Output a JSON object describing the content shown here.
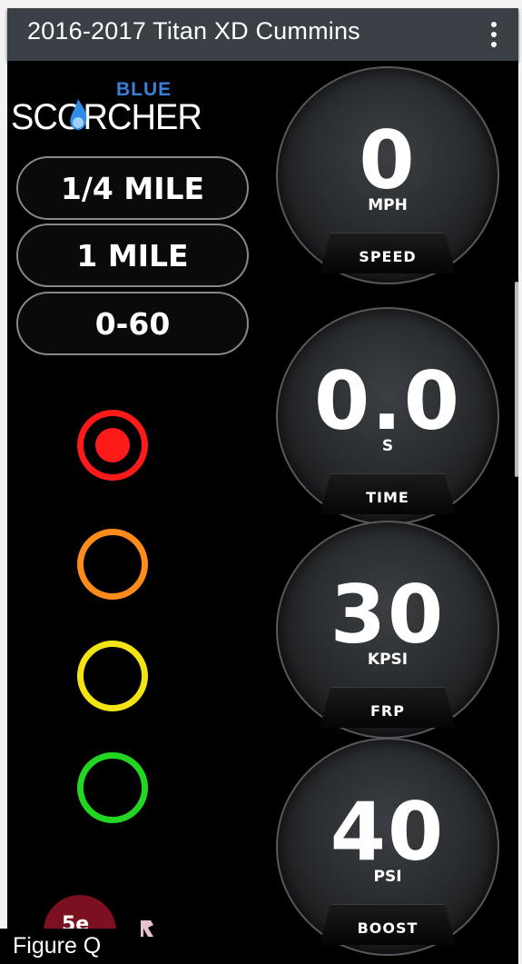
{
  "appbar": {
    "title": "2016-2017 Titan XD Cummins",
    "menu_icon": "more-vert-icon"
  },
  "logo": {
    "top": "BLUE",
    "word": "SCORCHER"
  },
  "modes": [
    {
      "label": "1/4 MILE"
    },
    {
      "label": "1 MILE"
    },
    {
      "label": "0-60"
    }
  ],
  "lights": [
    {
      "color": "#ff1a1a",
      "active": true
    },
    {
      "color": "#ff8c1a",
      "active": false
    },
    {
      "color": "#f2e313",
      "active": false
    },
    {
      "color": "#22d622",
      "active": false
    }
  ],
  "gauges": [
    {
      "value": "0",
      "unit": "MPH",
      "label": "SPEED"
    },
    {
      "value": "0.0",
      "unit": "S",
      "label": "TIME"
    },
    {
      "value": "30",
      "unit": "KPSI",
      "label": "FRP"
    },
    {
      "value": "40",
      "unit": "PSI",
      "label": "BOOST"
    }
  ],
  "bottom": {
    "logo_text": "5e",
    "figure": "Figure Q"
  }
}
